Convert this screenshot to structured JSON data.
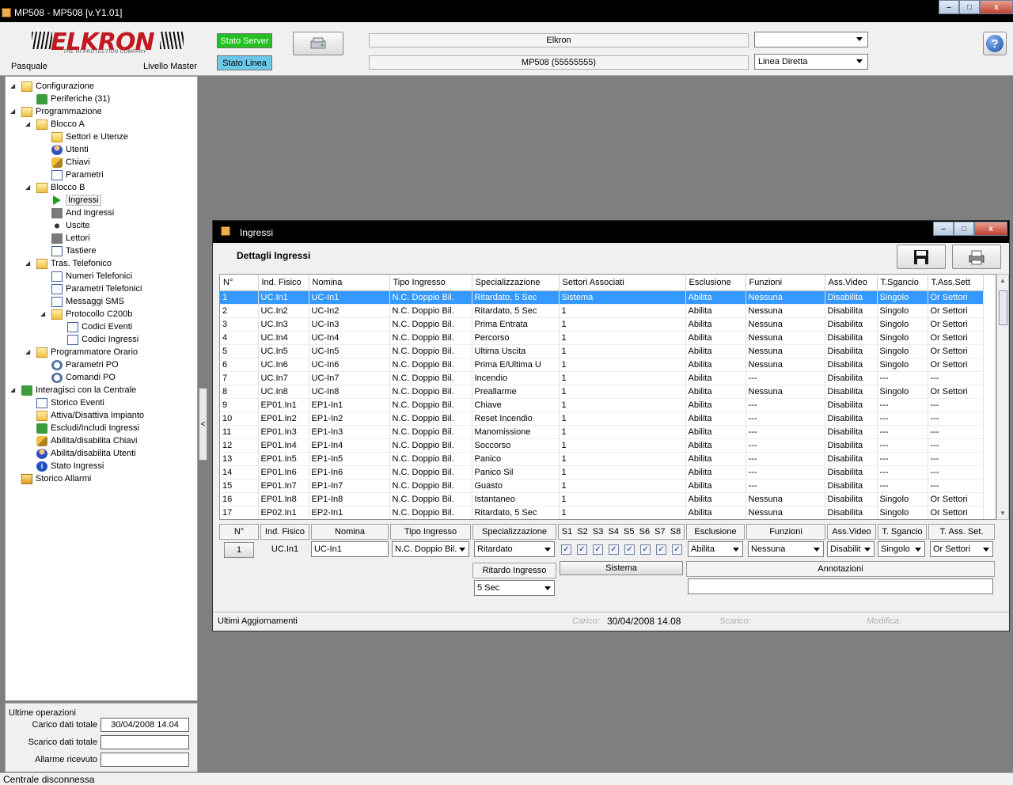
{
  "window": {
    "title": "MP508 - MP508 [v.Y1.01]"
  },
  "header": {
    "logo_text": "ELKRON",
    "logo_tagline": "THE HI-PROTECTION COMPANY",
    "user": "Pasquale",
    "level": "Livello Master",
    "stato_server": "Stato Server",
    "stato_linea": "Stato Linea",
    "central_name": "Elkron",
    "central_model": "MP508 (55555555)",
    "combo_top": "",
    "combo_line": "Linea Diretta",
    "help": "?",
    "colors": {
      "server_ok": "#22c022",
      "linea": "#6cc8e8"
    }
  },
  "tree": {
    "items": [
      {
        "label": "Configurazione",
        "icon": "folder-icon"
      },
      {
        "label": "Periferiche (31)",
        "icon": "network-icon"
      },
      {
        "label": "Programmazione",
        "icon": "folder-icon"
      },
      {
        "label": "Blocco A",
        "icon": "folder-icon"
      },
      {
        "label": "Settori e Utenze",
        "icon": "house-icon"
      },
      {
        "label": "Utenti",
        "icon": "user-icon"
      },
      {
        "label": "Chiavi",
        "icon": "key-icon"
      },
      {
        "label": "Parametri",
        "icon": "parameters-icon"
      },
      {
        "label": "Blocco B",
        "icon": "folder-icon"
      },
      {
        "label": "Ingressi",
        "icon": "arrow-right-icon"
      },
      {
        "label": "And Ingressi",
        "icon": "and-icon"
      },
      {
        "label": "Uscite",
        "icon": "speaker-icon"
      },
      {
        "label": "Lettori",
        "icon": "reader-icon"
      },
      {
        "label": "Tastiere",
        "icon": "keyboard-icon"
      },
      {
        "label": "Tras. Telefonico",
        "icon": "folder-icon"
      },
      {
        "label": "Numeri Telefonici",
        "icon": "phone-icon"
      },
      {
        "label": "Parametri Telefonici",
        "icon": "phone-icon"
      },
      {
        "label": "Messaggi SMS",
        "icon": "sms-icon"
      },
      {
        "label": "Protocollo C200b",
        "icon": "folder-icon"
      },
      {
        "label": "Codici Eventi",
        "icon": "document-icon"
      },
      {
        "label": "Codici Ingressi",
        "icon": "document-icon"
      },
      {
        "label": "Programmatore Orario",
        "icon": "folder-icon"
      },
      {
        "label": "Parametri PO",
        "icon": "clock-icon"
      },
      {
        "label": "Comandi PO",
        "icon": "clock-icon"
      },
      {
        "label": "Interagisci con la Centrale",
        "icon": "interact-icon"
      },
      {
        "label": "Storico Eventi",
        "icon": "log-icon"
      },
      {
        "label": "Attiva/Disattiva Impianto",
        "icon": "house-icon"
      },
      {
        "label": "Escludi/Includi Ingressi",
        "icon": "exclude-icon"
      },
      {
        "label": "Abilita/disabilita Chiavi",
        "icon": "key-icon"
      },
      {
        "label": "Abilita/disabilita Utenti",
        "icon": "user-icon"
      },
      {
        "label": "Stato Ingressi",
        "icon": "info-icon"
      },
      {
        "label": "Storico Allarmi",
        "icon": "alarm-icon"
      }
    ]
  },
  "ops": {
    "title": "Ultime operazioni",
    "carico_label": "Carico dati totale",
    "carico_value": "30/04/2008 14.04",
    "scarico_label": "Scarico dati totale",
    "scarico_value": "",
    "allarme_label": "Allarme ricevuto",
    "allarme_value": ""
  },
  "statusbar": "Centrale disconnessa",
  "child": {
    "title": "Ingressi",
    "heading": "Dettagli Ingressi",
    "columns": [
      "N°",
      "Ind. Fisico",
      "Nomina",
      "Tipo Ingresso",
      "Specializzazione",
      "Settori Associati",
      "Esclusione",
      "Funzioni",
      "Ass.Video",
      "T.Sgancio",
      "T.Ass.Sett"
    ],
    "rows": [
      [
        "1",
        "UC.In1",
        "UC-In1",
        "N.C. Doppio Bil.",
        "Ritardato, 5 Sec",
        "Sistema",
        "Abilita",
        "Nessuna",
        "Disabilita",
        "Singolo",
        "Or Settori"
      ],
      [
        "2",
        "UC.In2",
        "UC-In2",
        "N.C. Doppio Bil.",
        "Ritardato, 5 Sec",
        "1",
        "Abilita",
        "Nessuna",
        "Disabilita",
        "Singolo",
        "Or Settori"
      ],
      [
        "3",
        "UC.In3",
        "UC-In3",
        "N.C. Doppio Bil.",
        "Prima Entrata",
        "1",
        "Abilita",
        "Nessuna",
        "Disabilita",
        "Singolo",
        "Or Settori"
      ],
      [
        "4",
        "UC.In4",
        "UC-In4",
        "N.C. Doppio Bil.",
        "Percorso",
        "1",
        "Abilita",
        "Nessuna",
        "Disabilita",
        "Singolo",
        "Or Settori"
      ],
      [
        "5",
        "UC.In5",
        "UC-In5",
        "N.C. Doppio Bil.",
        "Ultima Uscita",
        "1",
        "Abilita",
        "Nessuna",
        "Disabilita",
        "Singolo",
        "Or Settori"
      ],
      [
        "6",
        "UC.In6",
        "UC-In6",
        "N.C. Doppio Bil.",
        "Prima E/Ultima U",
        "1",
        "Abilita",
        "Nessuna",
        "Disabilita",
        "Singolo",
        "Or Settori"
      ],
      [
        "7",
        "UC.In7",
        "UC-In7",
        "N.C. Doppio Bil.",
        "Incendio",
        "1",
        "Abilita",
        "---",
        "Disabilita",
        "---",
        "---"
      ],
      [
        "8",
        "UC.In8",
        "UC-In8",
        "N.C. Doppio Bil.",
        "Preallarme",
        "1",
        "Abilita",
        "Nessuna",
        "Disabilita",
        "Singolo",
        "Or Settori"
      ],
      [
        "9",
        "EP01.In1",
        "EP1-In1",
        "N.C. Doppio Bil.",
        "Chiave",
        "1",
        "Abilita",
        "---",
        "Disabilita",
        "---",
        "---"
      ],
      [
        "10",
        "EP01.In2",
        "EP1-In2",
        "N.C. Doppio Bil.",
        "Reset Incendio",
        "1",
        "Abilita",
        "---",
        "Disabilita",
        "---",
        "---"
      ],
      [
        "11",
        "EP01.In3",
        "EP1-In3",
        "N.C. Doppio Bil.",
        "Manomissione",
        "1",
        "Abilita",
        "---",
        "Disabilita",
        "---",
        "---"
      ],
      [
        "12",
        "EP01.In4",
        "EP1-In4",
        "N.C. Doppio Bil.",
        "Soccorso",
        "1",
        "Abilita",
        "---",
        "Disabilita",
        "---",
        "---"
      ],
      [
        "13",
        "EP01.In5",
        "EP1-In5",
        "N.C. Doppio Bil.",
        "Panico",
        "1",
        "Abilita",
        "---",
        "Disabilita",
        "---",
        "---"
      ],
      [
        "14",
        "EP01.In6",
        "EP1-In6",
        "N.C. Doppio Bil.",
        "Panico Sil",
        "1",
        "Abilita",
        "---",
        "Disabilita",
        "---",
        "---"
      ],
      [
        "15",
        "EP01.In7",
        "EP1-In7",
        "N.C. Doppio Bil.",
        "Guasto",
        "1",
        "Abilita",
        "---",
        "Disabilita",
        "---",
        "---"
      ],
      [
        "16",
        "EP01.In8",
        "EP1-In8",
        "N.C. Doppio Bil.",
        "Istantaneo",
        "1",
        "Abilita",
        "Nessuna",
        "Disabilita",
        "Singolo",
        "Or Settori"
      ],
      [
        "17",
        "EP02.In1",
        "EP2-In1",
        "N.C. Doppio Bil.",
        "Ritardato, 5 Sec",
        "1",
        "Abilita",
        "Nessuna",
        "Disabilita",
        "Singolo",
        "Or Settori"
      ]
    ],
    "editor": {
      "headers": {
        "n": "N°",
        "ind": "Ind. Fisico",
        "nomina": "Nomina",
        "tipo": "Tipo Ingresso",
        "spec": "Specializzazione",
        "settori": "S1  S2  S3  S4  S5  S6  S7  S8",
        "esclusione": "Esclusione",
        "funzioni": "Funzioni",
        "video": "Ass.Video",
        "sgancio": "T. Sgancio",
        "asset": "T. Ass. Set."
      },
      "n": "1",
      "ind": "UC.In1",
      "nomina": "UC-In1",
      "tipo": "N.C. Doppio Bil.",
      "spec": "Ritardato",
      "esclusione": "Abilita",
      "funzioni": "Nessuna",
      "video": "Disabilit",
      "sgancio": "Singolo",
      "asset": "Or Settori",
      "ritardo_label": "Ritardo Ingresso",
      "ritardo_value": "5 Sec",
      "sistema_label": "Sistema",
      "annotazioni_label": "Annotazioni",
      "annotazioni_value": ""
    },
    "status": {
      "label": "Ultimi Aggiornamenti",
      "carico_label": "Carico:",
      "carico_value": "30/04/2008 14.08",
      "scarico_label": "Scarico:",
      "modifica_label": "Modifica:"
    }
  }
}
